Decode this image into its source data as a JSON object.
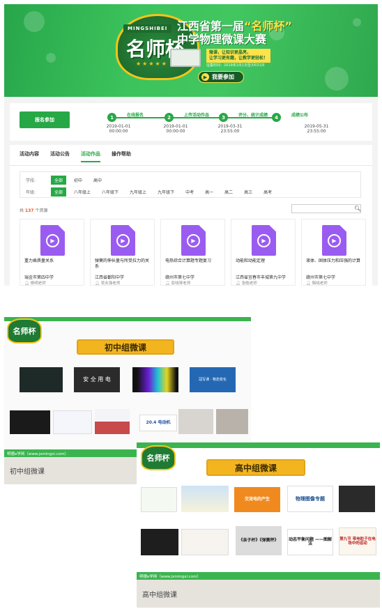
{
  "banner": {
    "logo_tag": "MINGSHIBEI",
    "logo_text": "名师杯",
    "logo_stars": "★★★★★",
    "title_line1_pre": "江西省第一届",
    "title_line1_hl": "“名师杯”",
    "title_line2": "中学物理微课大赛",
    "slogan_line1": "微课，让知识更晶亮，",
    "slogan_line2": "让学习更有趣，让教学更轻松！",
    "period": "征集时间：2019年1月1日至3月31日",
    "join_label": "我要参加",
    "join_icon": "arrow-right-icon"
  },
  "timeline": {
    "signup_label": "报名参加",
    "steps": [
      {
        "num": "1",
        "name": "在线报名",
        "date": "2019-01-01",
        "time": "00:00:00"
      },
      {
        "num": "2",
        "name": "上传活动作品",
        "date": "2019-01-01",
        "time": "00:00:00"
      },
      {
        "num": "3",
        "name": "评分、统计成绩",
        "date": "2019-03-31",
        "time": "23:55:00"
      },
      {
        "num": "4",
        "name": "成绩公布",
        "date": "2019-05-31",
        "time": "23:55:00"
      }
    ]
  },
  "tabs": [
    "活动内容",
    "活动公告",
    "活动作品",
    "操作帮助"
  ],
  "active_tab": "活动作品",
  "filters": {
    "stage_label": "学段:",
    "stage_options": [
      "全部",
      "初中",
      "高中"
    ],
    "grade_label": "年级:",
    "grade_options": [
      "全部",
      "八年级上",
      "八年级下",
      "九年级上",
      "九年级下",
      "中考",
      "高一",
      "高二",
      "高三",
      "高考"
    ]
  },
  "results": {
    "prefix": "共",
    "count": "137",
    "suffix": "个资源"
  },
  "search": {
    "placeholder": ""
  },
  "works": [
    {
      "title": "重力乘质量关系",
      "school": "瑞金市第四中学",
      "teacher": "杨明老师"
    },
    {
      "title": "弹簧的伸长量与所受拉力的关系",
      "school": "江西省鄱阳中学",
      "teacher": "吴永强老师"
    },
    {
      "title": "电热综合计算题专题复习",
      "school": "赣州市第七中学",
      "teacher": "彭晓琴老师"
    },
    {
      "title": "动能和动能定理",
      "school": "江西省宜春市丰城第九中学",
      "teacher": "张皓老师"
    },
    {
      "title": "液体、固体压力和压强的计算",
      "school": "赣州市第七中学",
      "teacher": "韩晓老师"
    }
  ],
  "middle_group": {
    "logo_text": "名师杯",
    "title": "初中组微课",
    "thumbs_row1": [
      "",
      "安 全 用 电",
      "",
      "冠写课 · 物态变化"
    ],
    "thumbs_row2": [
      "",
      "",
      "",
      "20.4 电动机",
      "",
      ""
    ],
    "footer_text": "明德e学网（www.jxmingxi.com）",
    "caption": "初中组微课"
  },
  "high_group": {
    "logo_text": "名师杯",
    "title": "高中组微课",
    "thumbs_row1": [
      "",
      "",
      "交流电的产生",
      "物理图像专题",
      ""
    ],
    "thumbs_row2": [
      "",
      "",
      "《亲子杯》《弹簧秤》",
      "动态平衡问题 ——图解法",
      "第九节 带电粒子在电场中的运动"
    ],
    "footer_text": "明德e学网（www.jxmingxi.com）",
    "caption": "高中组微课"
  },
  "colors": {
    "brand_green": "#27a846",
    "accent_orange": "#e95a24",
    "file_purple": "#9a5cf0",
    "gold": "#f2b520"
  }
}
